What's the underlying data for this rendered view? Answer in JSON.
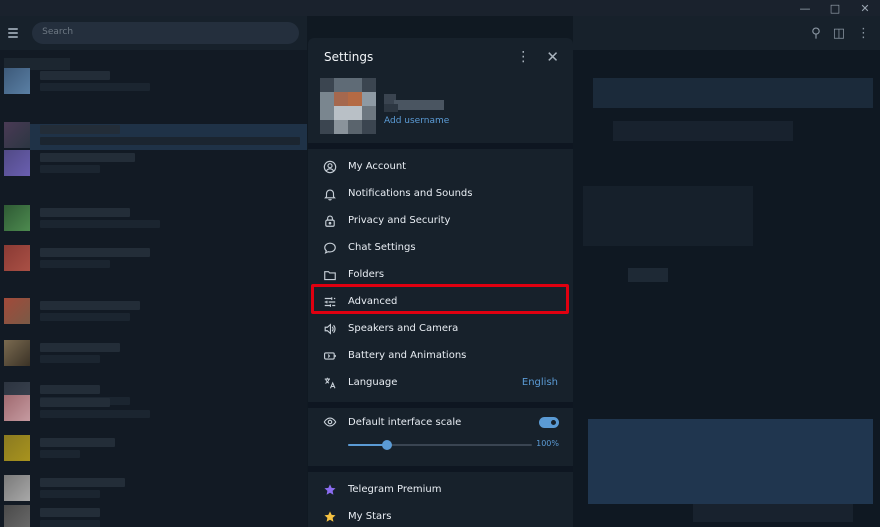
{
  "search": {
    "placeholder": "Search"
  },
  "settings": {
    "title": "Settings",
    "profile": {
      "username_link": "Add username"
    },
    "menu": [
      {
        "label": "My Account",
        "icon": "user-circle-icon"
      },
      {
        "label": "Notifications and Sounds",
        "icon": "bell-icon"
      },
      {
        "label": "Privacy and Security",
        "icon": "lock-icon"
      },
      {
        "label": "Chat Settings",
        "icon": "chat-bubble-icon"
      },
      {
        "label": "Folders",
        "icon": "folder-icon"
      },
      {
        "label": "Advanced",
        "icon": "sliders-icon"
      },
      {
        "label": "Speakers and Camera",
        "icon": "speaker-icon"
      },
      {
        "label": "Battery and Animations",
        "icon": "battery-icon"
      },
      {
        "label": "Language",
        "icon": "translate-icon",
        "value": "English"
      }
    ],
    "scale": {
      "label": "Default interface scale",
      "enabled": true,
      "value": "100%",
      "position": 0.21
    },
    "extra": [
      {
        "label": "Telegram Premium",
        "icon": "star-premium-icon"
      },
      {
        "label": "My Stars",
        "icon": "star-icon"
      }
    ]
  },
  "colors": {
    "accent": "#5b9bd5",
    "highlight": "#e00010",
    "premium": "#8b6cf0",
    "stars": "#f5c242"
  }
}
